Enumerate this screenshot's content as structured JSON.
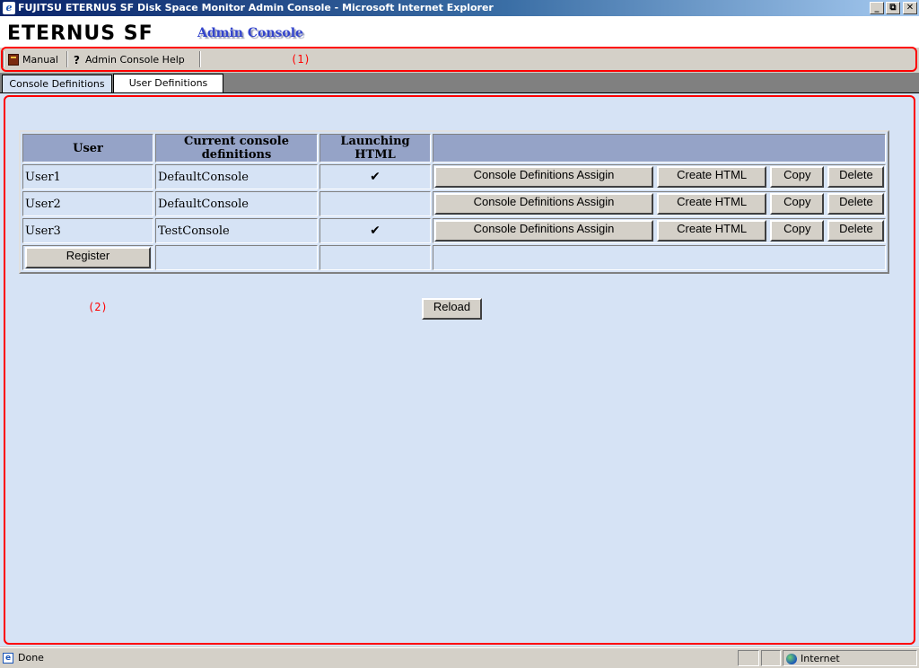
{
  "window": {
    "title": "FUJITSU ETERNUS SF Disk Space Monitor Admin Console - Microsoft Internet Explorer",
    "minimize": "_",
    "maximize": "⧉",
    "close": "✕"
  },
  "header": {
    "logo": "ETERNUS SF",
    "subtitle": "Admin Console"
  },
  "toolbar": {
    "manual_label": "Manual",
    "help_label": "Admin Console Help"
  },
  "callouts": {
    "one": "(1)",
    "two": "(2)"
  },
  "tabs": [
    {
      "label": "Console Definitions",
      "active": false
    },
    {
      "label": "User Definitions",
      "active": true
    }
  ],
  "table": {
    "headers": [
      "User",
      "Current console definitions",
      "Launching HTML",
      ""
    ],
    "rows": [
      {
        "user": "User1",
        "console": "DefaultConsole",
        "launching": "✔"
      },
      {
        "user": "User2",
        "console": "DefaultConsole",
        "launching": ""
      },
      {
        "user": "User3",
        "console": "TestConsole",
        "launching": "✔"
      }
    ],
    "row_buttons": {
      "assign": "Console Definitions Assigin",
      "create": "Create HTML",
      "copy": "Copy",
      "delete": "Delete"
    },
    "register_label": "Register"
  },
  "reload_label": "Reload",
  "status": {
    "text": "Done",
    "zone": "Internet"
  },
  "colors": {
    "content_bg": "#d6e3f5",
    "header_cell_bg": "#95a3c7",
    "callout": "#ff0000"
  }
}
